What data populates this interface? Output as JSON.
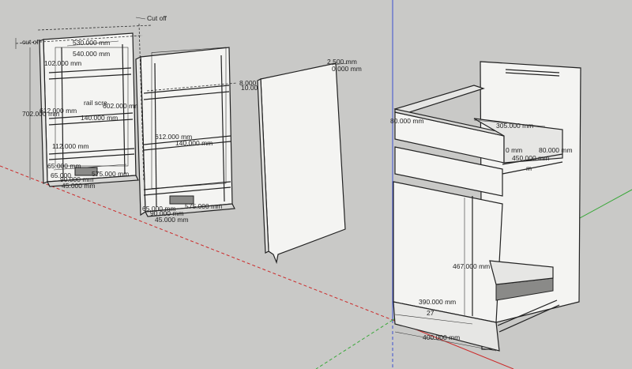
{
  "scene": {
    "axes": {
      "red": "#cc2a2a",
      "green": "#3aa83a",
      "blue": "#3a4fd0"
    },
    "background": "#c9c9c7"
  },
  "labels": {
    "cut_off_top": "Cut off",
    "cut_off_left": "cut off",
    "panel1": {
      "w530": "530.000 mm",
      "w540": "540.000 mm",
      "d102": "102.000 mm",
      "h702": "702.000 mm",
      "d612": "612.000 mm",
      "rail": "rail scre",
      "d602": "602.000 mm",
      "d140": "140.000 mm",
      "d112": "112.000 mm",
      "d65": "65.000 mm",
      "d575": "575.000 mm",
      "d65b": "65.000",
      "d90": "90.000 mm",
      "d45": "45.000 mm"
    },
    "panel2": {
      "d8": "8.000 mm",
      "d10": "10.000 mm",
      "d612": "612.000 mm",
      "d140": "140.000 mm",
      "d65": "65.000 mm",
      "d90": "90.000 mm",
      "d45": "45.000 mm",
      "d575": "575.000 mm"
    },
    "panel3": {
      "d2_5": "2.500 mm",
      "d0": "0.000 mm"
    },
    "cabinet": {
      "d80": "80.000 mm",
      "d305": "305.000 mm",
      "d450": "450.000 mm",
      "d80b": "80.000 mm",
      "d0": "0 mm",
      "m": "m",
      "d467": "467.000 mm",
      "d390": "390.000 mm",
      "d27": "27",
      "d400": "400.000 mm"
    }
  }
}
